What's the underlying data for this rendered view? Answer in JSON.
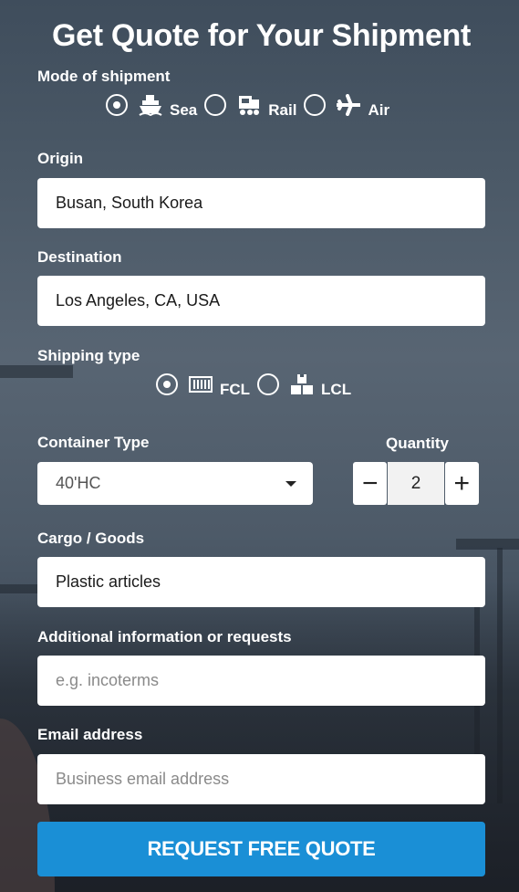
{
  "title": "Get Quote for Your Shipment",
  "mode": {
    "label": "Mode of shipment",
    "options": [
      {
        "label": "Sea",
        "icon": "ship-icon",
        "checked": true
      },
      {
        "label": "Rail",
        "icon": "train-icon",
        "checked": false
      },
      {
        "label": "Air",
        "icon": "plane-icon",
        "checked": false
      }
    ]
  },
  "origin": {
    "label": "Origin",
    "value": "Busan, South Korea"
  },
  "destination": {
    "label": "Destination",
    "value": "Los Angeles, CA, USA"
  },
  "shipping_type": {
    "label": "Shipping type",
    "options": [
      {
        "label": "FCL",
        "icon": "container-icon",
        "checked": true
      },
      {
        "label": "LCL",
        "icon": "boxes-icon",
        "checked": false
      }
    ]
  },
  "container": {
    "label": "Container Type",
    "value": "40'HC"
  },
  "quantity": {
    "label": "Quantity",
    "value": "2",
    "minus": "−",
    "plus": "+"
  },
  "cargo": {
    "label": "Cargo / Goods",
    "value": "Plastic articles"
  },
  "additional": {
    "label": "Additional information or requests",
    "placeholder": "e.g. incoterms"
  },
  "email": {
    "label": "Email address",
    "placeholder": "Business email address"
  },
  "submit_label": "REQUEST FREE QUOTE",
  "colors": {
    "accent": "#1a8fd6"
  }
}
